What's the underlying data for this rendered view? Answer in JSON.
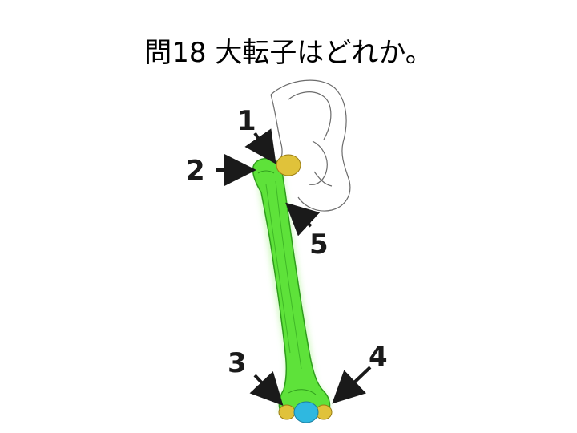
{
  "question": {
    "title": "問18 大転子はどれか。"
  },
  "figure": {
    "labels": [
      "1",
      "2",
      "3",
      "4",
      "5"
    ],
    "colors": {
      "femur": "#5ee23a",
      "femur_glow": "#b8f5a0",
      "femur_outline": "#2f9d1c",
      "hip_outline": "#555555",
      "cartilage": "#e0c23a",
      "patella": "#2fb8e0",
      "arrow": "#1a1a1a"
    },
    "icons": [
      "femur-bone",
      "pelvis-outline",
      "arrow"
    ]
  }
}
